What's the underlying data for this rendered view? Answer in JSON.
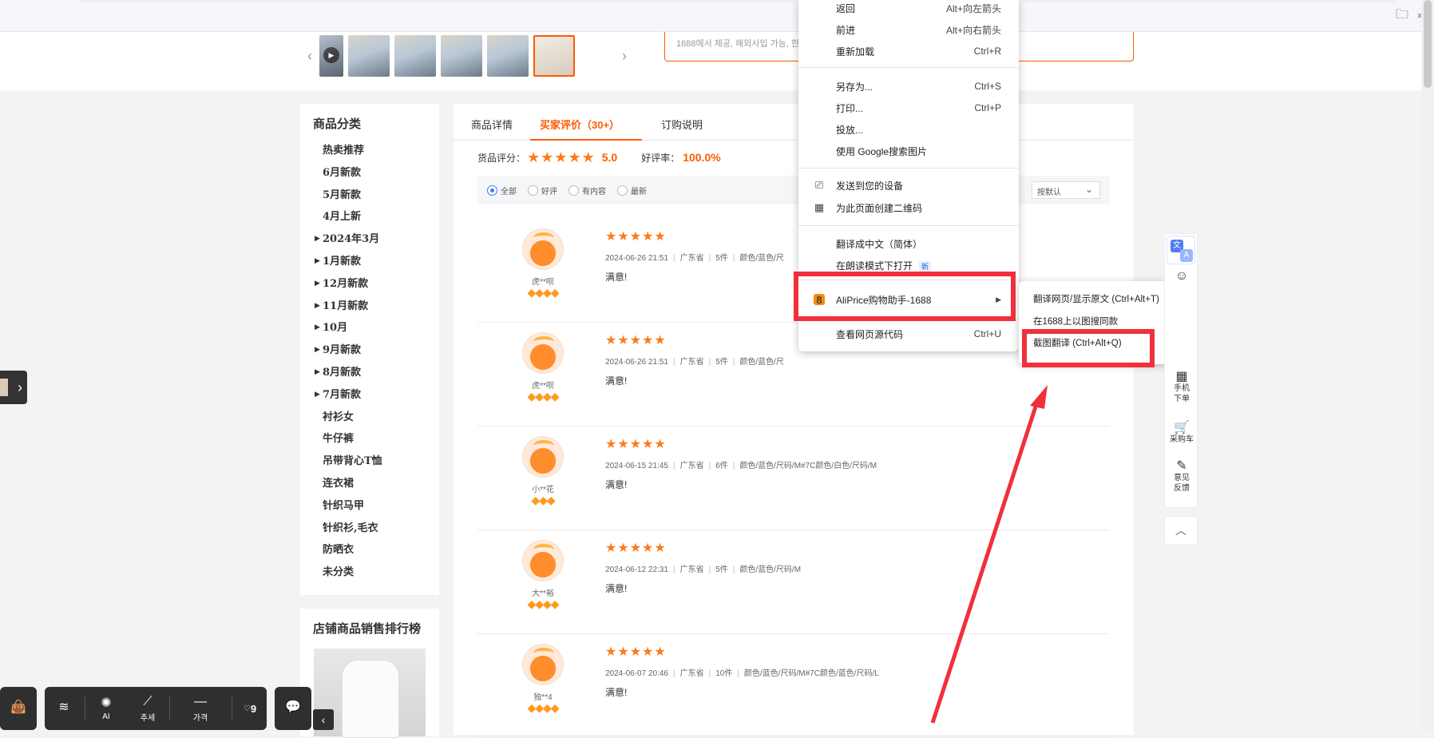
{
  "topbar": {
    "folder_label": "»"
  },
  "notice": {
    "text": "1688에서 제공, 해외사입 가능, 한"
  },
  "categories": {
    "title": "商品分类",
    "items": [
      {
        "label": "热卖推荐",
        "arrow": false
      },
      {
        "label": "6月新款",
        "arrow": false
      },
      {
        "label": "5月新款",
        "arrow": false
      },
      {
        "label": "4月上新",
        "arrow": false
      },
      {
        "label": "2024年3月",
        "arrow": true
      },
      {
        "label": "1月新款",
        "arrow": true
      },
      {
        "label": "12月新款",
        "arrow": true
      },
      {
        "label": "11月新款",
        "arrow": true
      },
      {
        "label": "10月",
        "arrow": true
      },
      {
        "label": "9月新款",
        "arrow": true
      },
      {
        "label": "8月新款",
        "arrow": true
      },
      {
        "label": "7月新款",
        "arrow": true
      },
      {
        "label": "衬衫女",
        "arrow": false
      },
      {
        "label": "牛仔裤",
        "arrow": false
      },
      {
        "label": "吊带背心T恤",
        "arrow": false
      },
      {
        "label": "连衣裙",
        "arrow": false
      },
      {
        "label": "针织马甲",
        "arrow": false
      },
      {
        "label": "针织衫,毛衣",
        "arrow": false
      },
      {
        "label": "防晒衣",
        "arrow": false
      },
      {
        "label": "未分类",
        "arrow": false
      }
    ]
  },
  "rank": {
    "title": "店铺商品销售排行榜"
  },
  "tabs": [
    {
      "label": "商品详情",
      "active": false
    },
    {
      "label": "买家评价（30+）",
      "active": true
    },
    {
      "label": "订购说明",
      "active": false
    }
  ],
  "score": {
    "label": "货品评分：",
    "value": "5.0",
    "rate_label": "好评率：",
    "rate_value": "100.0%"
  },
  "filters": {
    "options": [
      {
        "label": "全部",
        "checked": true
      },
      {
        "label": "好评",
        "checked": false
      },
      {
        "label": "有内容",
        "checked": false
      },
      {
        "label": "最新",
        "checked": false
      }
    ],
    "sort_label": "按默认"
  },
  "reviews": [
    {
      "nick": "虎**呗",
      "gems": 4,
      "date": "2024-06-26 21:51",
      "province": "广东省",
      "qty": "5件",
      "spec": "颜色/蓝色/尺",
      "text": "满意!"
    },
    {
      "nick": "虎**呗",
      "gems": 4,
      "date": "2024-06-26 21:51",
      "province": "广东省",
      "qty": "5件",
      "spec": "颜色/蓝色/尺",
      "text": "满意!"
    },
    {
      "nick": "小**花",
      "gems": 3,
      "date": "2024-06-15 21:45",
      "province": "广东省",
      "qty": "6件",
      "spec": "颜色/蓝色/尺码/M#7C颜色/白色/尺码/M",
      "text": "满意!"
    },
    {
      "nick": "大**裕",
      "gems": 4,
      "date": "2024-06-12 22:31",
      "province": "广东省",
      "qty": "5件",
      "spec": "颜色/蓝色/尺码/M",
      "text": "满意!"
    },
    {
      "nick": "独**4",
      "gems": 4,
      "date": "2024-06-07 20:46",
      "province": "广东省",
      "qty": "10件",
      "spec": "颜色/蓝色/尺码/M#7C颜色/蓝色/尺码/L",
      "text": "满意!"
    }
  ],
  "context_menu": {
    "items": [
      {
        "label": "返回",
        "shortcut": "Alt+向左箭头"
      },
      {
        "label": "前进",
        "shortcut": "Alt+向右箭头"
      },
      {
        "label": "重新加载",
        "shortcut": "Ctrl+R"
      },
      {
        "label": "另存为...",
        "shortcut": "Ctrl+S"
      },
      {
        "label": "打印...",
        "shortcut": "Ctrl+P"
      },
      {
        "label": "投放...",
        "shortcut": ""
      },
      {
        "label": "使用 Google搜索图片",
        "shortcut": ""
      },
      {
        "label": "发送到您的设备",
        "shortcut": ""
      },
      {
        "label": "为此页面创建二维码",
        "shortcut": ""
      },
      {
        "label": "翻译成中文（简体）",
        "shortcut": ""
      },
      {
        "label": "在朗读模式下打开",
        "shortcut": "",
        "badge": "新"
      },
      {
        "label": "AliPrice购物助手-1688",
        "shortcut": ""
      },
      {
        "label": "查看网页源代码",
        "shortcut": "Ctrl+U"
      }
    ],
    "ali_icon": "8"
  },
  "submenu": {
    "items": [
      {
        "label": "翻译网页/显示原文 (Ctrl+Alt+T)"
      },
      {
        "label": "在1688上以图搜同款"
      },
      {
        "label": "截图翻译 (Ctrl+Alt+Q)"
      }
    ]
  },
  "side_tools": [
    {
      "label": "手机\n下单",
      "icon": "qr-icon"
    },
    {
      "label": "采购车",
      "icon": "cart-icon"
    },
    {
      "label": "意见\n反馈",
      "icon": "edit-icon"
    }
  ],
  "bottom_toolbar": {
    "ai_label": "AI",
    "trend_label": "추세",
    "price_label": "가격",
    "heart_count": "9"
  },
  "colors": {
    "accent": "#ff5a00",
    "highlight": "#f0303a",
    "star": "#ff7a1a"
  }
}
